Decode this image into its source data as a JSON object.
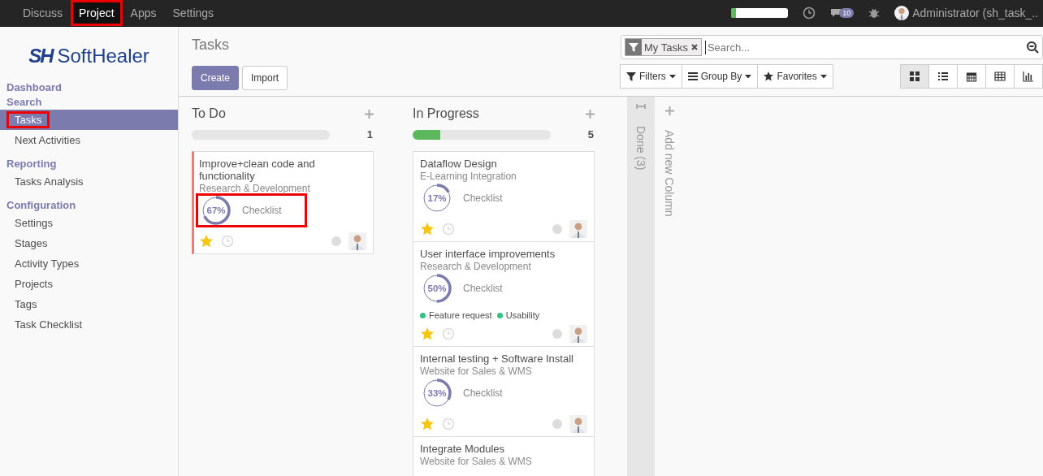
{
  "top_menu": [
    {
      "label": "Discuss",
      "selected": false,
      "highlighted": false
    },
    {
      "label": "Project",
      "selected": true,
      "highlighted": true
    },
    {
      "label": "Apps",
      "selected": false,
      "highlighted": false
    },
    {
      "label": "Settings",
      "selected": false,
      "highlighted": false
    }
  ],
  "systray": {
    "progress": {
      "level": 0.08
    },
    "messages_badge": "10",
    "user": "Administrator (sh_task_.."
  },
  "logo": {
    "mark": "SH",
    "name": "SoftHealer"
  },
  "sidebar": {
    "sections": [
      {
        "title": "Dashboard"
      },
      {
        "title": "Search",
        "items": [
          {
            "label": "Tasks",
            "selected": true,
            "highlighted": true
          },
          {
            "label": "Next Activities",
            "selected": false,
            "highlighted": false
          }
        ]
      },
      {
        "title": "Reporting",
        "items": [
          {
            "label": "Tasks Analysis",
            "selected": false,
            "highlighted": false
          }
        ]
      },
      {
        "title": "Configuration",
        "items": [
          {
            "label": "Settings",
            "selected": false,
            "highlighted": false
          },
          {
            "label": "Stages",
            "selected": false,
            "highlighted": false
          },
          {
            "label": "Activity Types",
            "selected": false,
            "highlighted": false
          },
          {
            "label": "Projects",
            "selected": false,
            "highlighted": false
          },
          {
            "label": "Tags",
            "selected": false,
            "highlighted": false
          },
          {
            "label": "Task Checklist",
            "selected": false,
            "highlighted": false
          }
        ]
      }
    ]
  },
  "control_panel": {
    "title": "Tasks",
    "buttons": [
      {
        "label": "Create",
        "kind": "primary"
      },
      {
        "label": "Import",
        "kind": "secondary"
      }
    ],
    "search": {
      "facet": "My Tasks",
      "placeholder": "Search..."
    },
    "search_options": [
      {
        "label": "Filters",
        "kind": "filter"
      },
      {
        "label": "Group By",
        "kind": "group"
      },
      {
        "label": "Favorites",
        "kind": "star"
      }
    ],
    "views": [
      {
        "kind": "kanban",
        "selected": true
      },
      {
        "kind": "list",
        "selected": false
      },
      {
        "kind": "calendar",
        "selected": false
      },
      {
        "kind": "pivot",
        "selected": false
      },
      {
        "kind": "graph",
        "selected": false
      }
    ]
  },
  "columns": [
    {
      "title": "To Do",
      "count": "1",
      "level": 0,
      "cards": [
        {
          "title": "Improve+clean code and functionality",
          "project": "Research & Development",
          "blocked": true,
          "checklist": {
            "percent": "67%",
            "level": 0.67,
            "label": "Checklist",
            "highlighted": true
          },
          "starred": true
        }
      ]
    },
    {
      "title": "In Progress",
      "count": "5",
      "level": 0.2,
      "cards": [
        {
          "title": "Dataflow Design",
          "project": "E-Learning Integration",
          "blocked": false,
          "checklist": {
            "percent": "17%",
            "level": 0.17,
            "label": "Checklist"
          },
          "starred": true
        },
        {
          "title": "User interface improvements",
          "project": "Research & Development",
          "blocked": false,
          "checklist": {
            "percent": "50%",
            "level": 0.5,
            "label": "Checklist"
          },
          "tags": [
            {
              "label": "Feature request",
              "color": "#30c381"
            },
            {
              "label": "Usability",
              "color": "#30c381"
            }
          ],
          "starred": true
        },
        {
          "title": "Internal testing + Software Install",
          "project": "Website for Sales & WMS",
          "blocked": false,
          "checklist": {
            "percent": "33%",
            "level": 0.33,
            "label": "Checklist"
          },
          "starred": true
        },
        {
          "title": "Integrate Modules",
          "project": "Website for Sales & WMS",
          "blocked": false
        }
      ]
    }
  ],
  "folded_column": {
    "title": "Done (3)"
  },
  "add_column": {
    "label": "Add new Column"
  }
}
